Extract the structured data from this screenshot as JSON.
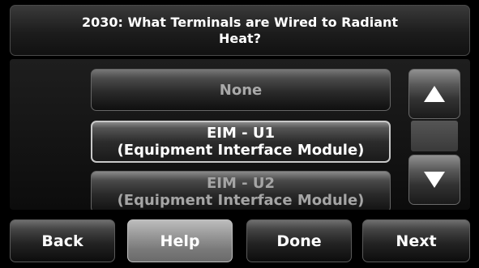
{
  "header": {
    "title": "2030: What Terminals are Wired to Radiant Heat?"
  },
  "options": [
    {
      "label": "None",
      "state": "default"
    },
    {
      "label_line1": "EIM - U1",
      "label_line2": "(Equipment Interface Module)",
      "state": "selected"
    },
    {
      "label_line1": "EIM - U2",
      "label_line2": "(Equipment Interface Module)",
      "state": "partially-visible"
    }
  ],
  "scroll": {
    "up_icon": "triangle-up-icon",
    "down_icon": "triangle-down-icon"
  },
  "footer": {
    "back_label": "Back",
    "help_label": "Help",
    "done_label": "Done",
    "next_label": "Next"
  }
}
